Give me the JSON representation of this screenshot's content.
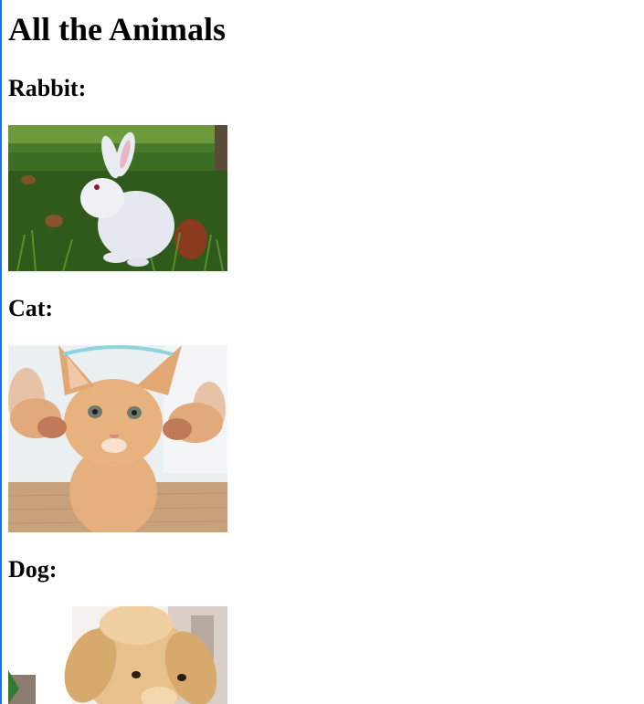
{
  "page": {
    "title": "All the Animals"
  },
  "animals": [
    {
      "label": "Rabbit:",
      "image_subject": "white-rabbit-in-grass"
    },
    {
      "label": "Cat:",
      "image_subject": "orange-kitten-held-by-paws"
    },
    {
      "label": "Dog:",
      "image_subject": "golden-retriever-puppy"
    }
  ],
  "colors": {
    "edge_accent": "#1a73e8"
  }
}
